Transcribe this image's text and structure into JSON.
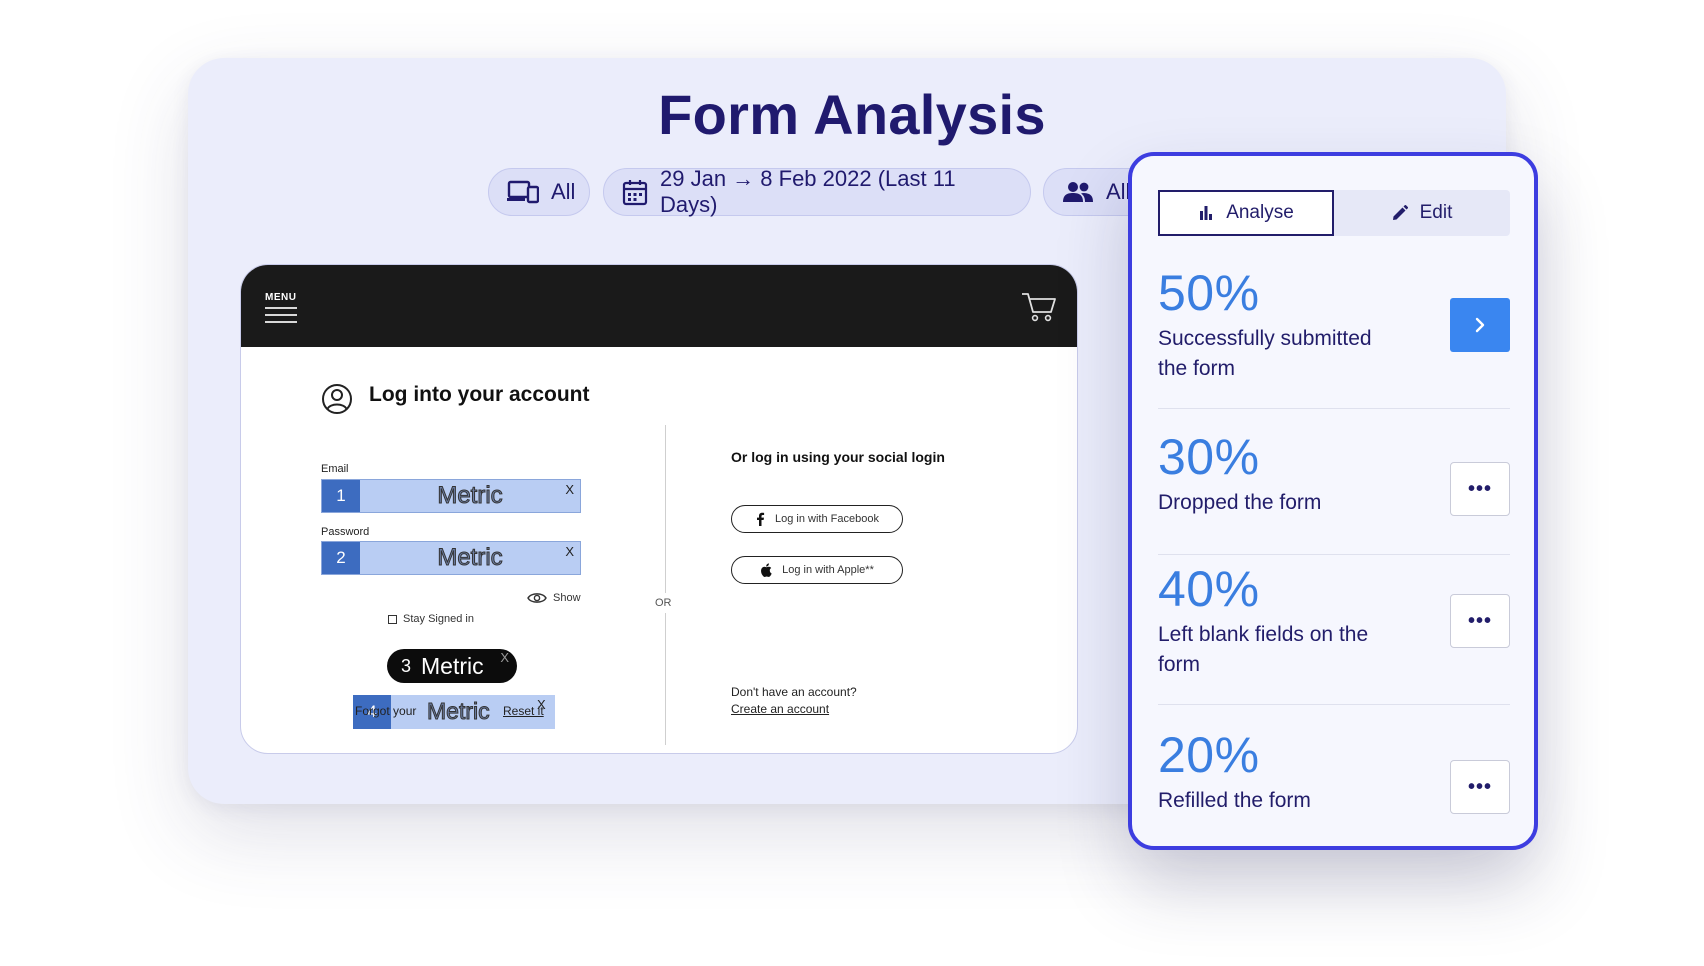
{
  "page": {
    "title": "Form Analysis"
  },
  "filters": {
    "device": {
      "label": "All",
      "icon": "devices-icon"
    },
    "date": {
      "label": "29 Jan → 8 Feb 2022 (Last 11 Days)",
      "icon": "calendar-icon"
    },
    "users": {
      "label": "All",
      "icon": "users-icon"
    }
  },
  "device_preview": {
    "menu_label": "MENU",
    "login_title": "Log into your account",
    "email_label": "Email",
    "password_label": "Password",
    "fields": [
      {
        "number": "1",
        "text": "Metric",
        "close": "X"
      },
      {
        "number": "2",
        "text": "Metric",
        "close": "X"
      }
    ],
    "show_label": "Show",
    "stay_signed_in": "Stay Signed in",
    "button_metric": {
      "number": "3",
      "text": "Metric",
      "close": "X"
    },
    "forgot": {
      "number": "4",
      "prefix": "Forgot your",
      "text": "Metric",
      "reset": "Reset it",
      "close": "X"
    },
    "or_label": "OR",
    "social_title": "Or log in using your social login",
    "facebook_label": "Log in with Facebook",
    "apple_label": "Log in with Apple**",
    "no_account": "Don't have an account?",
    "create_account": "Create an account"
  },
  "panel": {
    "tabs": {
      "analyse": "Analyse",
      "edit": "Edit"
    },
    "stats": [
      {
        "percent": "50%",
        "label": "Successfully submitted the form",
        "action": "chevron-right-icon"
      },
      {
        "percent": "30%",
        "label": "Dropped the form",
        "action": "more-icon"
      },
      {
        "percent": "40%",
        "label": "Left blank fields on the form",
        "action": "more-icon"
      },
      {
        "percent": "20%",
        "label": "Refilled the form",
        "action": "more-icon"
      }
    ],
    "more_glyph": "•••"
  },
  "colors": {
    "title": "#201a6e",
    "accent_blue": "#3a7ee0",
    "panel_border": "#3d3de0",
    "card_bg": "#ebedfb"
  }
}
